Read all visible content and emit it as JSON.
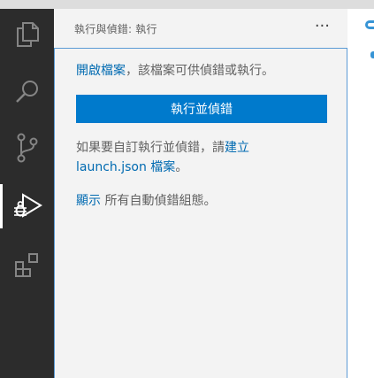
{
  "activity_bar": {
    "items": [
      {
        "icon": "explorer-icon",
        "active": false
      },
      {
        "icon": "search-icon",
        "active": false
      },
      {
        "icon": "source-control-icon",
        "active": false
      },
      {
        "icon": "run-debug-icon",
        "active": true
      },
      {
        "icon": "extensions-icon",
        "active": false
      }
    ]
  },
  "sidebar": {
    "title": "執行與偵錯: 執行",
    "more_actions": "···",
    "welcome": {
      "open_file_link": "開啟檔案",
      "open_file_text": "，該檔案可供偵錯或執行。",
      "run_button_label": "執行並偵錯",
      "customize_text": "如果要自訂執行並偵錯，請",
      "create_link": "建立",
      "launch_json_link": "launch.json 檔案",
      "period": "。",
      "show_link": "顯示",
      "show_text": " 所有自動偵錯組態。"
    }
  },
  "colors": {
    "activity_bar_bg": "#2c2c2c",
    "sidebar_bg": "#f3f3f3",
    "primary_button": "#007acc",
    "link": "#006ab1",
    "focus_border": "#5b9bd5"
  }
}
